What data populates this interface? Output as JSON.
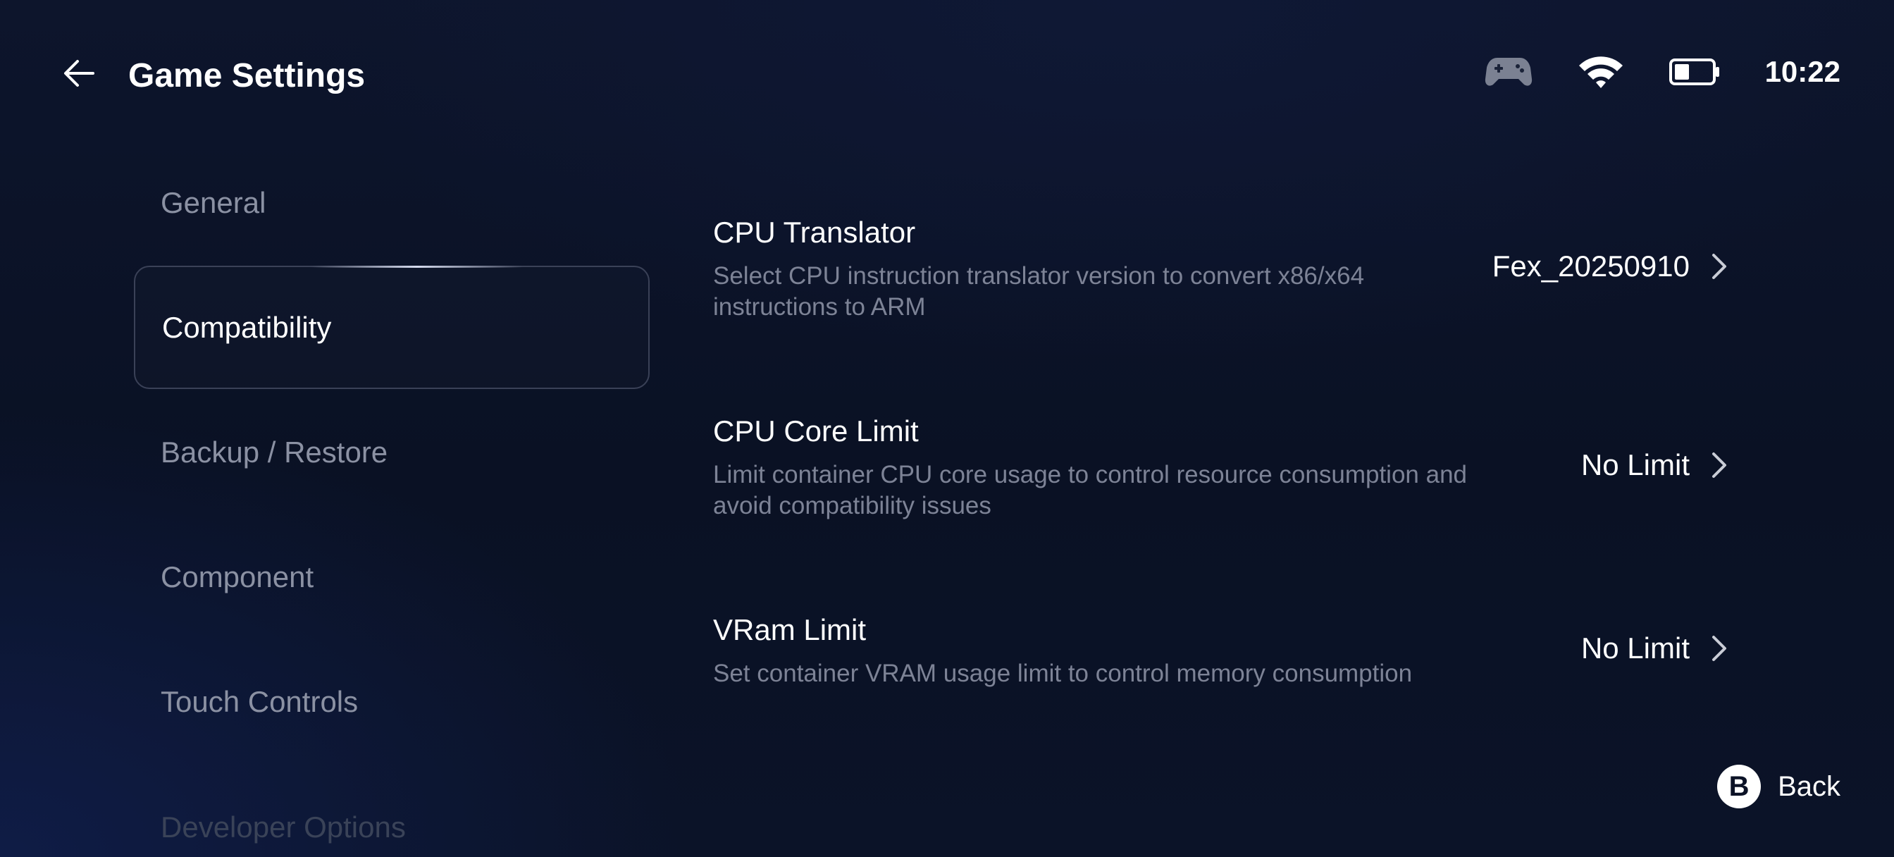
{
  "header": {
    "title": "Game Settings",
    "back_icon": "arrow-left-icon"
  },
  "status": {
    "icons": [
      "gamepad-icon",
      "wifi-icon",
      "battery-icon"
    ],
    "time": "10:22"
  },
  "sidebar": {
    "items": [
      {
        "label": "General",
        "selected": false
      },
      {
        "label": "Compatibility",
        "selected": true
      },
      {
        "label": "Backup / Restore",
        "selected": false
      },
      {
        "label": "Component",
        "selected": false
      },
      {
        "label": "Touch Controls",
        "selected": false
      },
      {
        "label": "Developer Options",
        "selected": false
      }
    ]
  },
  "settings": [
    {
      "title": "CPU Translator",
      "description": "Select CPU instruction translator version to convert x86/x64 instructions to ARM",
      "value": "Fex_20250910"
    },
    {
      "title": "CPU Core Limit",
      "description": "Limit container CPU core usage to control resource consumption and avoid compatibility issues",
      "value": "No Limit"
    },
    {
      "title": "VRam Limit",
      "description": "Set container VRAM usage limit to control memory consumption",
      "value": "No Limit"
    }
  ],
  "footer": {
    "button_glyph": "B",
    "back_label": "Back"
  },
  "colors": {
    "background": "#0b1328",
    "text_primary": "#ffffff",
    "text_secondary": "#7d8396",
    "nav_inactive": "#8b91a3",
    "selected_border": "#3a4157"
  }
}
